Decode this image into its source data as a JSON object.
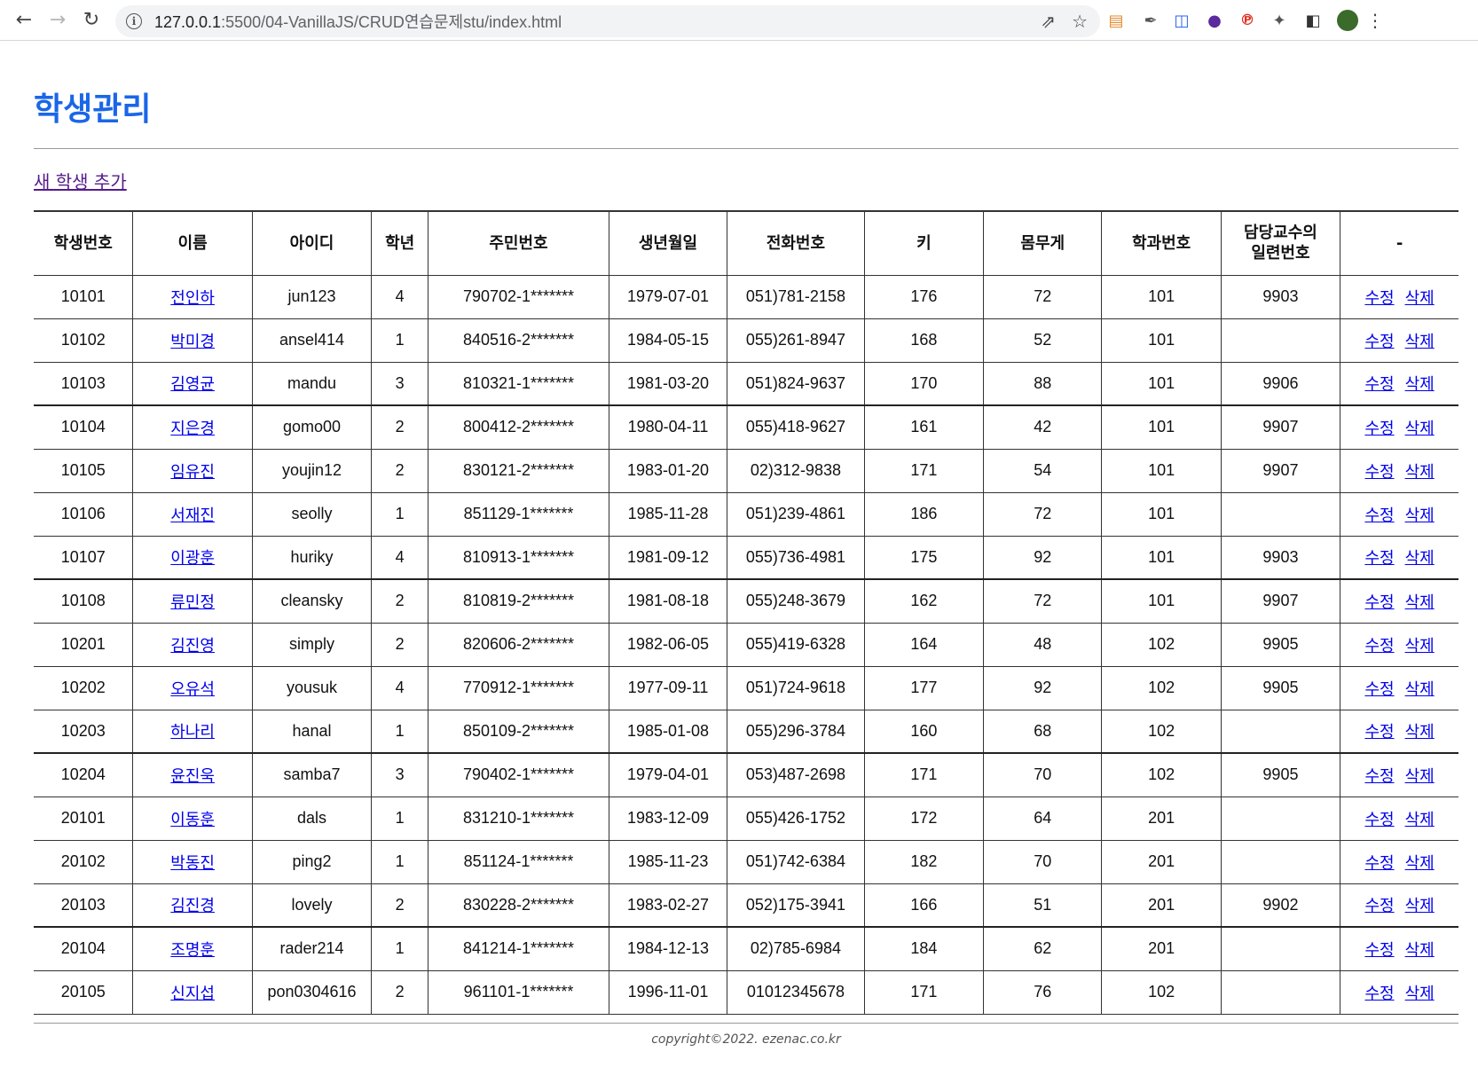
{
  "browser": {
    "url_host": "127.0.0.1",
    "url_path": ":5500/04-VanillaJS/CRUD연습문제stu/index.html"
  },
  "page": {
    "title": "학생관리",
    "add_link": "새 학생 추가",
    "footer": "copyright©2022. ezenac.co.kr"
  },
  "table": {
    "headers": [
      "학생번호",
      "이름",
      "아이디",
      "학년",
      "주민번호",
      "생년월일",
      "전화번호",
      "키",
      "몸무게",
      "학과번호",
      "담당교수의 일련번호",
      "-"
    ],
    "edit_label": "수정",
    "delete_label": "삭제",
    "rows": [
      [
        "10101",
        "전인하",
        "jun123",
        "4",
        "790702-1*******",
        "1979-07-01",
        "051)781-2158",
        "176",
        "72",
        "101",
        "9903"
      ],
      [
        "10102",
        "박미경",
        "ansel414",
        "1",
        "840516-2*******",
        "1984-05-15",
        "055)261-8947",
        "168",
        "52",
        "101",
        ""
      ],
      [
        "10103",
        "김영균",
        "mandu",
        "3",
        "810321-1*******",
        "1981-03-20",
        "051)824-9637",
        "170",
        "88",
        "101",
        "9906"
      ],
      [
        "10104",
        "지은경",
        "gomo00",
        "2",
        "800412-2*******",
        "1980-04-11",
        "055)418-9627",
        "161",
        "42",
        "101",
        "9907"
      ],
      [
        "10105",
        "임유진",
        "youjin12",
        "2",
        "830121-2*******",
        "1983-01-20",
        "02)312-9838",
        "171",
        "54",
        "101",
        "9907"
      ],
      [
        "10106",
        "서재진",
        "seolly",
        "1",
        "851129-1*******",
        "1985-11-28",
        "051)239-4861",
        "186",
        "72",
        "101",
        ""
      ],
      [
        "10107",
        "이광훈",
        "huriky",
        "4",
        "810913-1*******",
        "1981-09-12",
        "055)736-4981",
        "175",
        "92",
        "101",
        "9903"
      ],
      [
        "10108",
        "류민정",
        "cleansky",
        "2",
        "810819-2*******",
        "1981-08-18",
        "055)248-3679",
        "162",
        "72",
        "101",
        "9907"
      ],
      [
        "10201",
        "김진영",
        "simply",
        "2",
        "820606-2*******",
        "1982-06-05",
        "055)419-6328",
        "164",
        "48",
        "102",
        "9905"
      ],
      [
        "10202",
        "오유석",
        "yousuk",
        "4",
        "770912-1*******",
        "1977-09-11",
        "051)724-9618",
        "177",
        "92",
        "102",
        "9905"
      ],
      [
        "10203",
        "하나리",
        "hanal",
        "1",
        "850109-2*******",
        "1985-01-08",
        "055)296-3784",
        "160",
        "68",
        "102",
        ""
      ],
      [
        "10204",
        "윤진욱",
        "samba7",
        "3",
        "790402-1*******",
        "1979-04-01",
        "053)487-2698",
        "171",
        "70",
        "102",
        "9905"
      ],
      [
        "20101",
        "이동훈",
        "dals",
        "1",
        "831210-1*******",
        "1983-12-09",
        "055)426-1752",
        "172",
        "64",
        "201",
        ""
      ],
      [
        "20102",
        "박동진",
        "ping2",
        "1",
        "851124-1*******",
        "1985-11-23",
        "051)742-6384",
        "182",
        "70",
        "201",
        ""
      ],
      [
        "20103",
        "김진경",
        "lovely",
        "2",
        "830228-2*******",
        "1983-02-27",
        "052)175-3941",
        "166",
        "51",
        "201",
        "9902"
      ],
      [
        "20104",
        "조명훈",
        "rader214",
        "1",
        "841214-1*******",
        "1984-12-13",
        "02)785-6984",
        "184",
        "62",
        "201",
        ""
      ],
      [
        "20105",
        "신지섭",
        "pon0304616",
        "2",
        "961101-1*******",
        "1996-11-01",
        "01012345678",
        "171",
        "76",
        "102",
        ""
      ]
    ]
  },
  "colors": {
    "title": "#1a66e8",
    "link": "#0000ee",
    "visited_link": "#551a8b"
  }
}
